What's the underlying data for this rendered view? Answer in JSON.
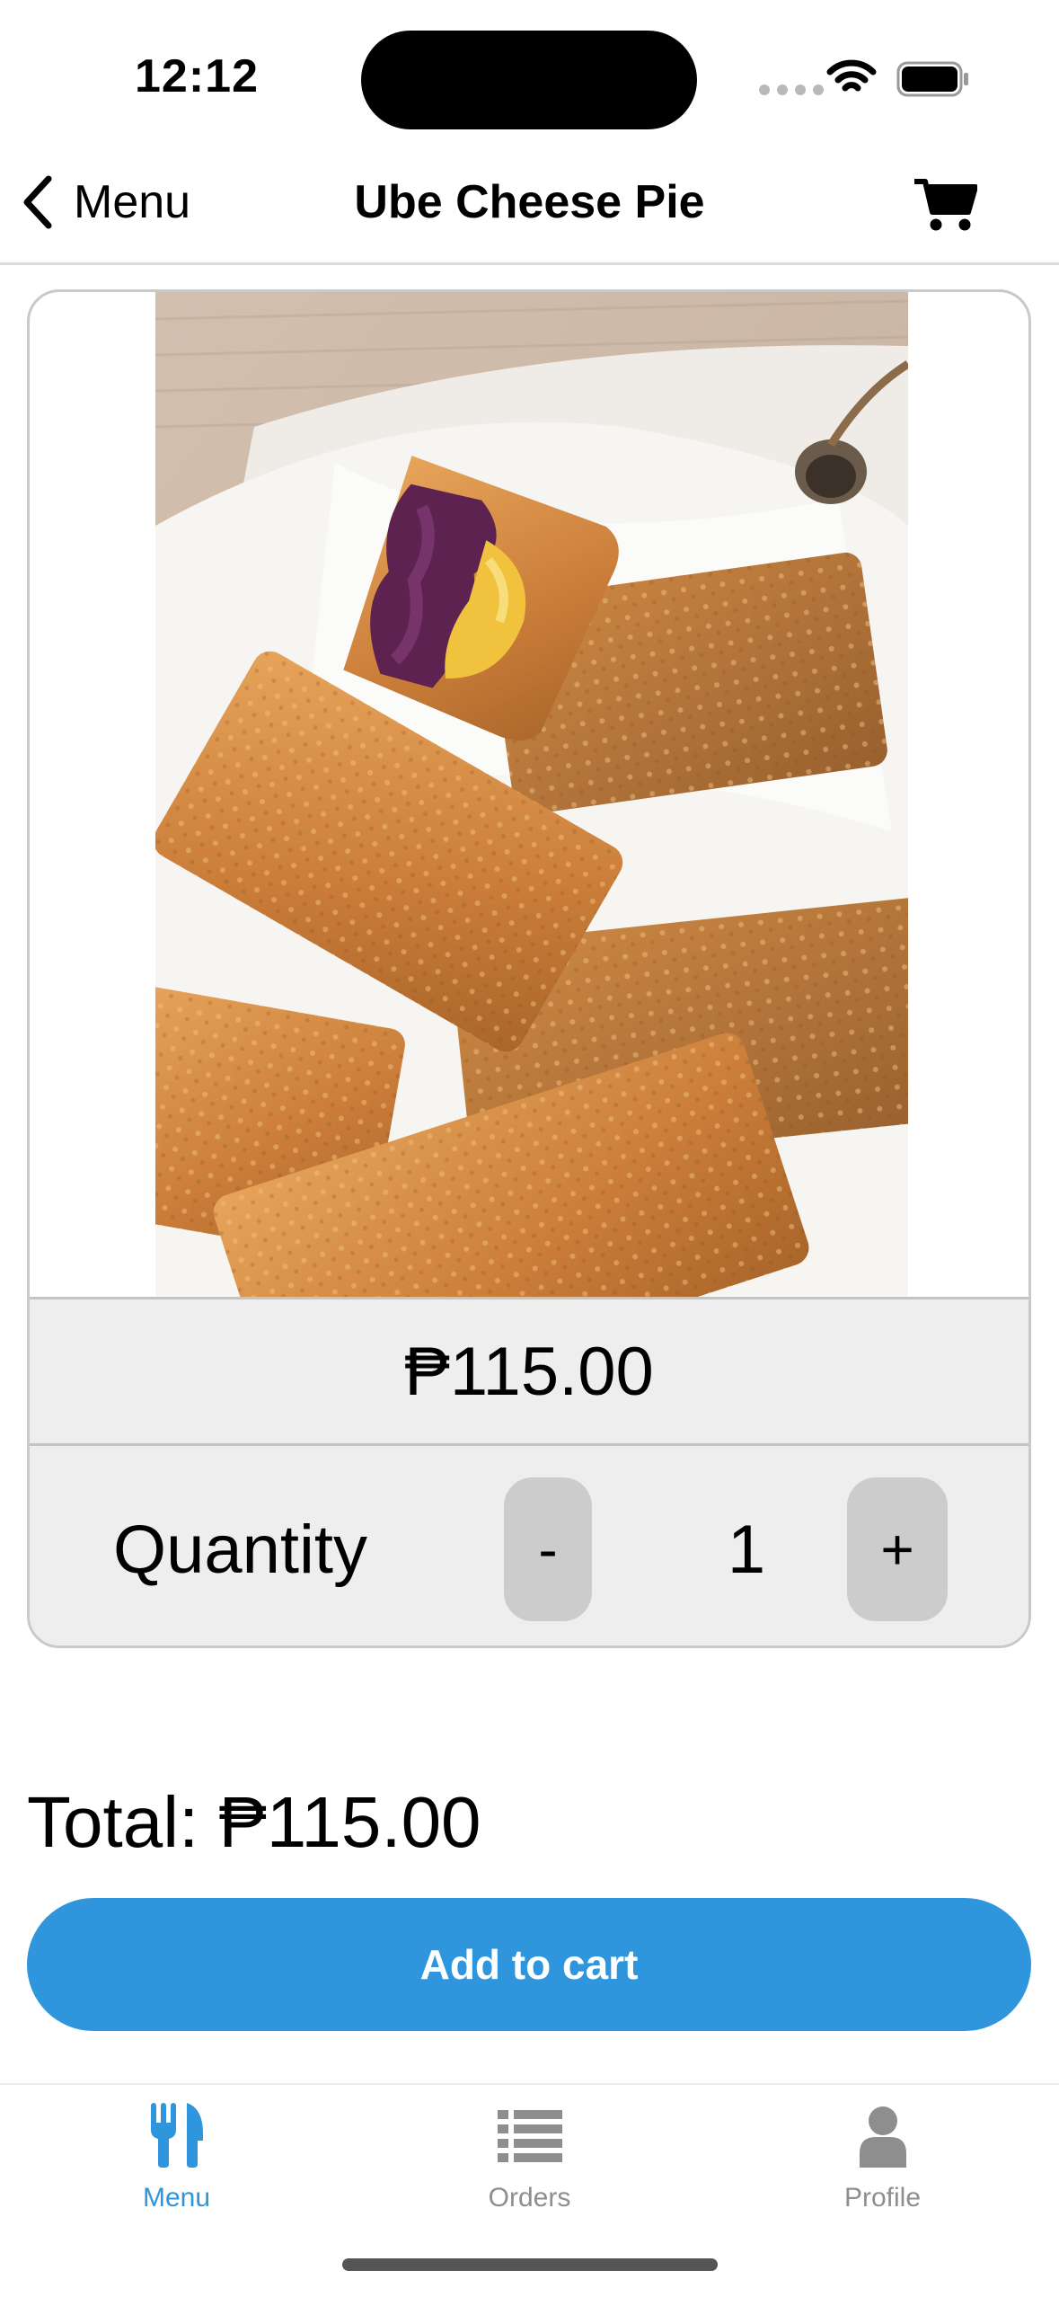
{
  "status_bar": {
    "time": "12:12"
  },
  "nav": {
    "back_label": "Menu",
    "title": "Ube Cheese Pie"
  },
  "product": {
    "price": "₱115.00",
    "quantity_label": "Quantity",
    "decrement_label": "-",
    "increment_label": "+",
    "quantity": "1"
  },
  "summary": {
    "total": "Total: ₱115.00"
  },
  "actions": {
    "add_to_cart": "Add to cart"
  },
  "tabs": [
    {
      "label": "Menu",
      "icon": "cutlery-icon",
      "active": true
    },
    {
      "label": "Orders",
      "icon": "list-icon",
      "active": false
    },
    {
      "label": "Profile",
      "icon": "person-icon",
      "active": false
    }
  ],
  "colors": {
    "accent": "#2f95dc",
    "inactive_tab": "#8e8e8e",
    "panel": "#eeeeee"
  }
}
